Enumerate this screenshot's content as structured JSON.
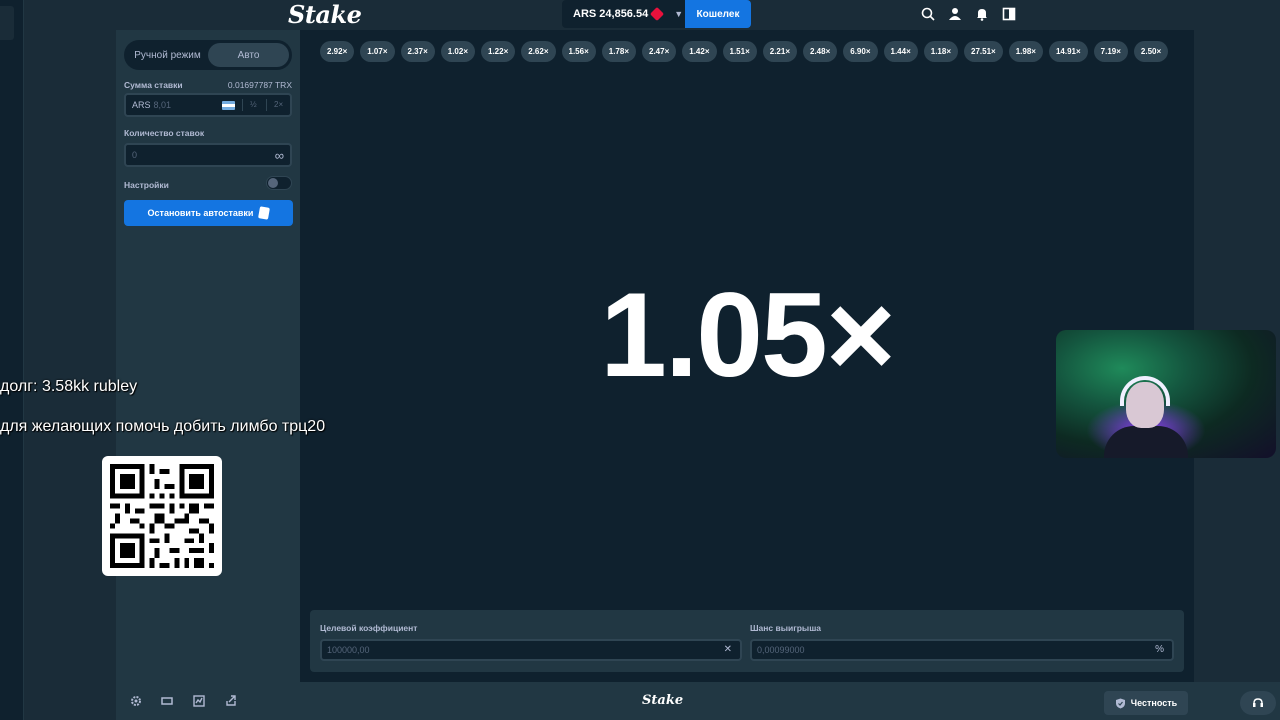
{
  "header": {
    "logo": "Stake",
    "balance": "ARS 24,856.54",
    "wallet_button": "Кошелек",
    "icons": [
      "search-icon",
      "user-icon",
      "bell-icon",
      "sidebar-toggle-icon"
    ]
  },
  "sidebar": {
    "mode_manual": "Ручной режим",
    "mode_auto": "Авто",
    "bet_amount_label": "Сумма ставки",
    "bet_amount_crypto": "0.01697787 TRX",
    "bet_currency": "ARS",
    "bet_value": "8,01",
    "half_label": "½",
    "double_label": "2×",
    "bet_count_label": "Количество ставок",
    "bet_count_value": "0",
    "settings_label": "Настройки",
    "stop_autobet_button": "Остановить автоставки"
  },
  "overlay": {
    "debt_text": "долг: 3.58kk rubley",
    "help_text": "для желающих помочь добить лимбо трц20"
  },
  "game": {
    "history": [
      "2.92×",
      "1.07×",
      "2.37×",
      "1.02×",
      "1.22×",
      "2.62×",
      "1.56×",
      "1.78×",
      "2.47×",
      "1.42×",
      "1.51×",
      "2.21×",
      "2.48×",
      "6.90×",
      "1.44×",
      "1.18×",
      "27.51×",
      "1.98×",
      "14.91×",
      "7.19×",
      "2.50×"
    ],
    "multiplier": "1.05×",
    "target_label": "Целевой коэффициент",
    "target_value": "100000,00",
    "target_clear": "✕",
    "win_chance_label": "Шанс выигрыша",
    "win_chance_value": "0,00099000",
    "win_chance_suffix": "%"
  },
  "footer": {
    "logo": "Stake",
    "fairness_button": "Честность",
    "icons": [
      "settings-icon",
      "theatre-mode-icon",
      "stats-icon",
      "popout-icon",
      "headset-icon"
    ]
  },
  "colors": {
    "background": "#1a2c38",
    "panel": "#213743",
    "game_bg": "#0f212e",
    "chip": "#2f4553",
    "accent_blue": "#1475e1"
  }
}
